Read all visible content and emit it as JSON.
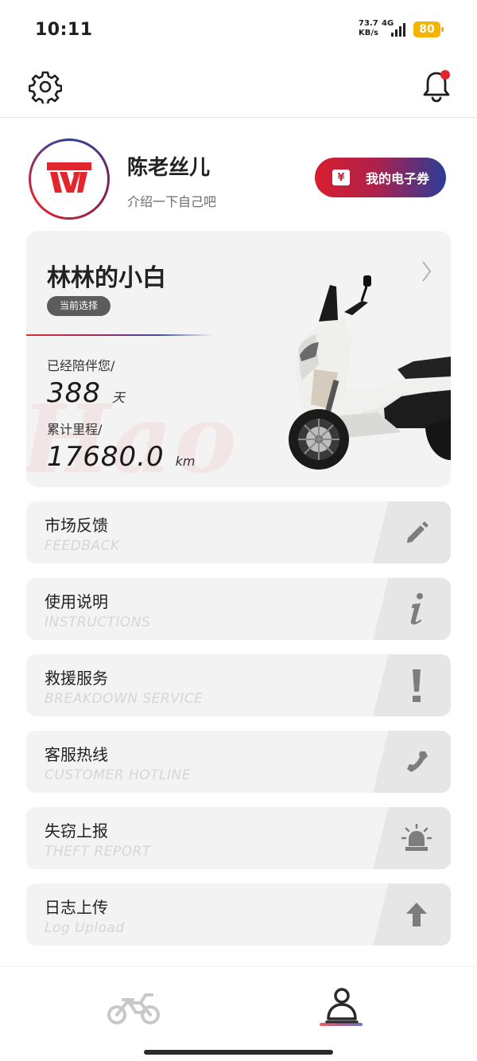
{
  "status_bar": {
    "time": "10:11",
    "net_speed_value": "73.7",
    "net_speed_unit": "KB/s",
    "network": "4G",
    "battery": "80",
    "battery_color": "#f4b400"
  },
  "header": {
    "settings_icon": "gear-icon",
    "notification_icon": "bell-icon",
    "has_unread": true
  },
  "profile": {
    "nickname": "陈老丝儿",
    "bio": "介绍一下自己吧",
    "coupon_label": "我的电子券",
    "coupon_icon_glyph": "¥"
  },
  "vehicle": {
    "name": "林林的小白",
    "badge": "当前选择",
    "days_label": "已经陪伴您/",
    "days_value": "388",
    "days_unit": "天",
    "mileage_label": "累计里程/",
    "mileage_value": "17680.0",
    "mileage_unit": "km",
    "watermark": "Hao"
  },
  "menu": [
    {
      "title": "市场反馈",
      "subtitle": "FEEDBACK",
      "icon": "pencil-icon"
    },
    {
      "title": "使用说明",
      "subtitle": "INSTRUCTIONS",
      "icon": "info-icon"
    },
    {
      "title": "救援服务",
      "subtitle": "BREAKDOWN SERVICE",
      "icon": "exclamation-icon"
    },
    {
      "title": "客服热线",
      "subtitle": "CUSTOMER HOTLINE",
      "icon": "phone-icon"
    },
    {
      "title": "失窃上报",
      "subtitle": "THEFT REPORT",
      "icon": "alarm-icon"
    },
    {
      "title": "日志上传",
      "subtitle": "Log Upload",
      "icon": "upload-arrow-icon"
    }
  ],
  "bottom_nav": {
    "tabs": [
      {
        "icon": "motorcycle-icon",
        "active": false
      },
      {
        "icon": "profile-icon",
        "active": true
      }
    ]
  },
  "colors": {
    "brand_red": "#e3262d",
    "brand_blue": "#2a3d98",
    "card_bg": "#f3f3f3"
  }
}
